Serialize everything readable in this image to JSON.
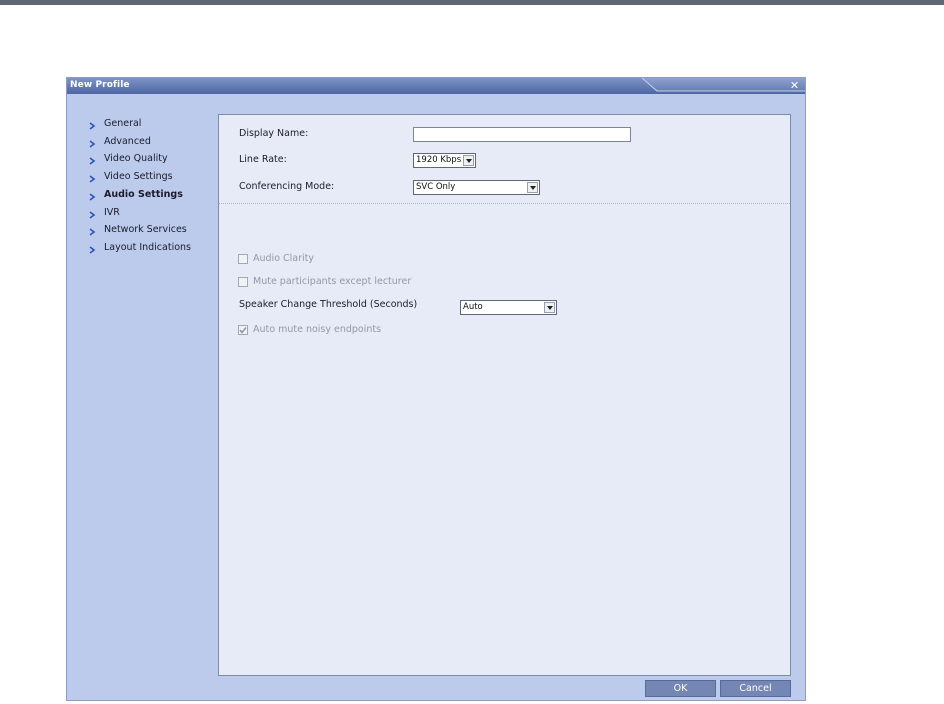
{
  "dialog": {
    "title": "New Profile",
    "close_glyph": "✕",
    "title_color": "#5a74b0"
  },
  "nav": {
    "items": [
      {
        "label": "General",
        "icon": "chevron-right-icon",
        "active": false
      },
      {
        "label": "Advanced",
        "icon": "chevron-right-icon",
        "active": false
      },
      {
        "label": "Video Quality",
        "icon": "chevron-right-icon",
        "active": false
      },
      {
        "label": "Video Settings",
        "icon": "chevron-right-icon",
        "active": false
      },
      {
        "label": "Audio Settings",
        "icon": "chevron-right-icon",
        "active": true
      },
      {
        "label": "IVR",
        "icon": "chevron-right-icon",
        "active": false
      },
      {
        "label": "Network Services",
        "icon": "chevron-right-icon",
        "active": false
      },
      {
        "label": "Layout Indications",
        "icon": "chevron-right-icon",
        "active": false
      }
    ]
  },
  "form": {
    "display_name": {
      "label": "Display Name:",
      "value": ""
    },
    "line_rate": {
      "label": "Line Rate:",
      "value": "1920 Kbps"
    },
    "conferencing_mode": {
      "label": "Conferencing Mode:",
      "value": "SVC Only"
    }
  },
  "audio": {
    "audio_clarity": {
      "label": "Audio Clarity",
      "checked": false,
      "disabled": true
    },
    "mute_except_lecturer": {
      "label": "Mute participants except lecturer",
      "checked": false,
      "disabled": true
    },
    "speaker_change_threshold": {
      "label": "Speaker Change Threshold (Seconds)",
      "value": "Auto"
    },
    "auto_mute_noisy": {
      "label": "Auto mute noisy endpoints",
      "checked": true,
      "disabled": true
    }
  },
  "buttons": {
    "ok": "OK",
    "cancel": "Cancel"
  }
}
